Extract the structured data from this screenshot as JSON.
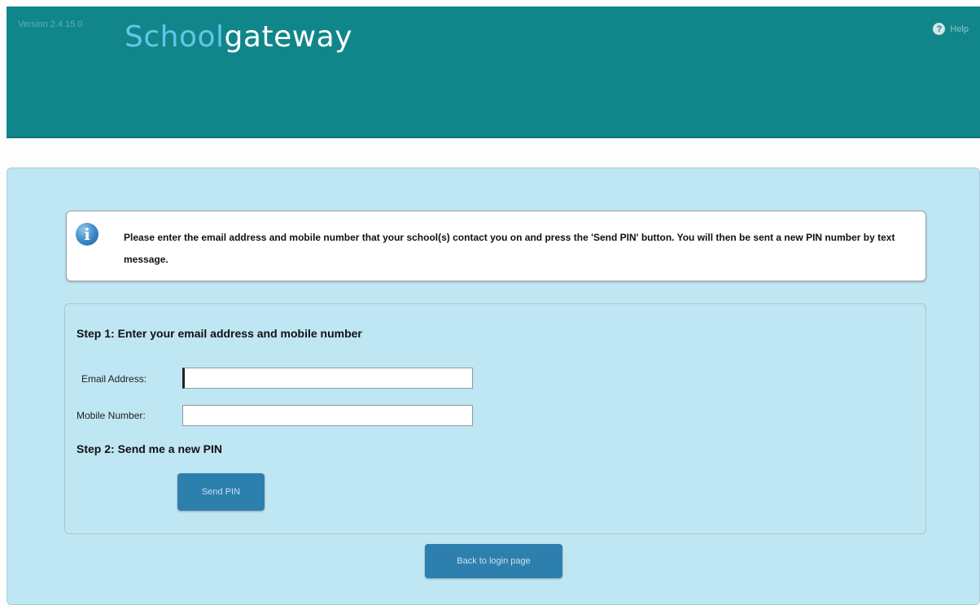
{
  "header": {
    "version": "Version 2.4.15.0",
    "logo_part1": "Scho",
    "logo_oo": "o",
    "logo_part2": "l",
    "logo_part3": "gateway",
    "help_icon_glyph": "?",
    "help_label": "Help"
  },
  "info": {
    "icon": "info-icon",
    "message": "Please enter the email address and mobile number that your school(s) contact you on and press the 'Send PIN' button. You will then be sent a new PIN number by text message."
  },
  "form": {
    "step1_title": "Step 1: Enter your email address and mobile number",
    "email_label": "Email Address:",
    "email_value": "",
    "mobile_label": "Mobile Number:",
    "mobile_value": "",
    "step2_title": "Step 2: Send me a new PIN",
    "send_button": "Send PIN"
  },
  "footer": {
    "back_button": "Back to login page"
  },
  "colors": {
    "header_bg": "#11868a",
    "panel_bg": "#bfe6f3",
    "button_bg": "#2d7fae",
    "logo_accent": "#62c6e8"
  }
}
